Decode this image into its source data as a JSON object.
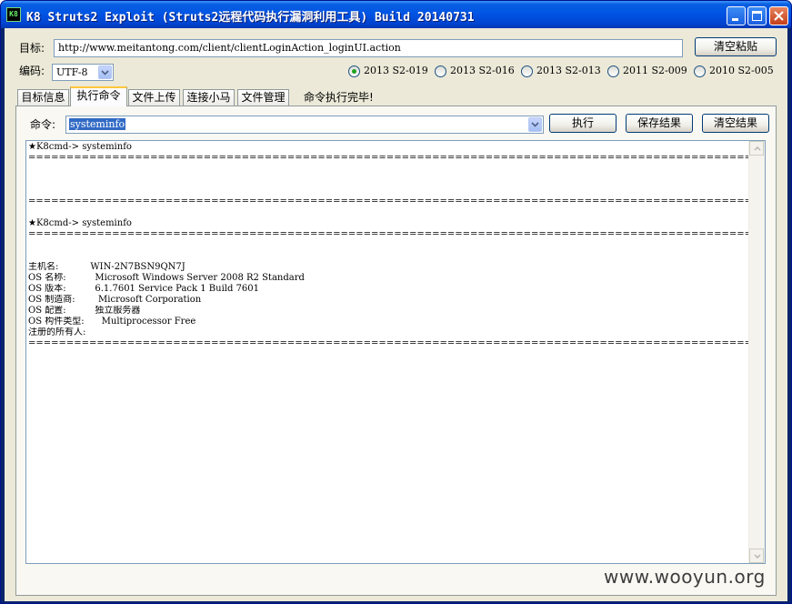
{
  "window": {
    "title": "K8 Struts2 Exploit (Struts2远程代码执行漏洞利用工具)  Build 20140731",
    "icon_text": "K8"
  },
  "target": {
    "label": "目标:",
    "url": "http://www.meitantong.com/client/clientLoginAction_loginUI.action",
    "clear_paste_button": "清空粘贴"
  },
  "encoding": {
    "label": "编码:",
    "selected": "UTF-8"
  },
  "exploits": {
    "options": [
      {
        "label": "2013 S2-019",
        "selected": true
      },
      {
        "label": "2013 S2-016",
        "selected": false
      },
      {
        "label": "2013 S2-013",
        "selected": false
      },
      {
        "label": "2011 S2-009",
        "selected": false
      },
      {
        "label": "2010 S2-005",
        "selected": false
      }
    ]
  },
  "tabs": [
    {
      "label": "目标信息",
      "active": false
    },
    {
      "label": "执行命令",
      "active": true
    },
    {
      "label": "文件上传",
      "active": false
    },
    {
      "label": "连接小马",
      "active": false
    },
    {
      "label": "文件管理",
      "active": false
    }
  ],
  "status": "命令执行完毕!",
  "command": {
    "label": "命令:",
    "value": "systeminfo",
    "execute_button": "执行",
    "save_button": "保存结果",
    "clear_button": "清空结果"
  },
  "output": {
    "lines": [
      "★K8cmd-> systeminfo",
      "=============================================================================================================================================================",
      "",
      "",
      "",
      "=============================================================================================================================================================",
      "",
      "★K8cmd-> systeminfo",
      "=============================================================================================================================================================",
      "",
      "",
      "主机名:           WIN-2N7BSN9QN7J",
      "OS 名称:          Microsoft Windows Server 2008 R2 Standard",
      "OS 版本:          6.1.7601 Service Pack 1 Build 7601",
      "OS 制造商:        Microsoft Corporation",
      "OS 配置:          独立服务器",
      "OS 构件类型:      Multiprocessor Free",
      "注册的所有人:",
      "============================================================================================================================================================="
    ]
  },
  "watermark": "www.wooyun.org",
  "colors": {
    "titlebar": "#0055e5",
    "client_bg": "#ece9d8",
    "active_tab_accent": "#ffc83c",
    "radio_dot": "#21a121"
  },
  "icons": [
    "app-icon",
    "minimize-icon",
    "maximize-icon",
    "close-icon",
    "chevron-down-icon",
    "scroll-up-icon",
    "scroll-down-icon"
  ]
}
